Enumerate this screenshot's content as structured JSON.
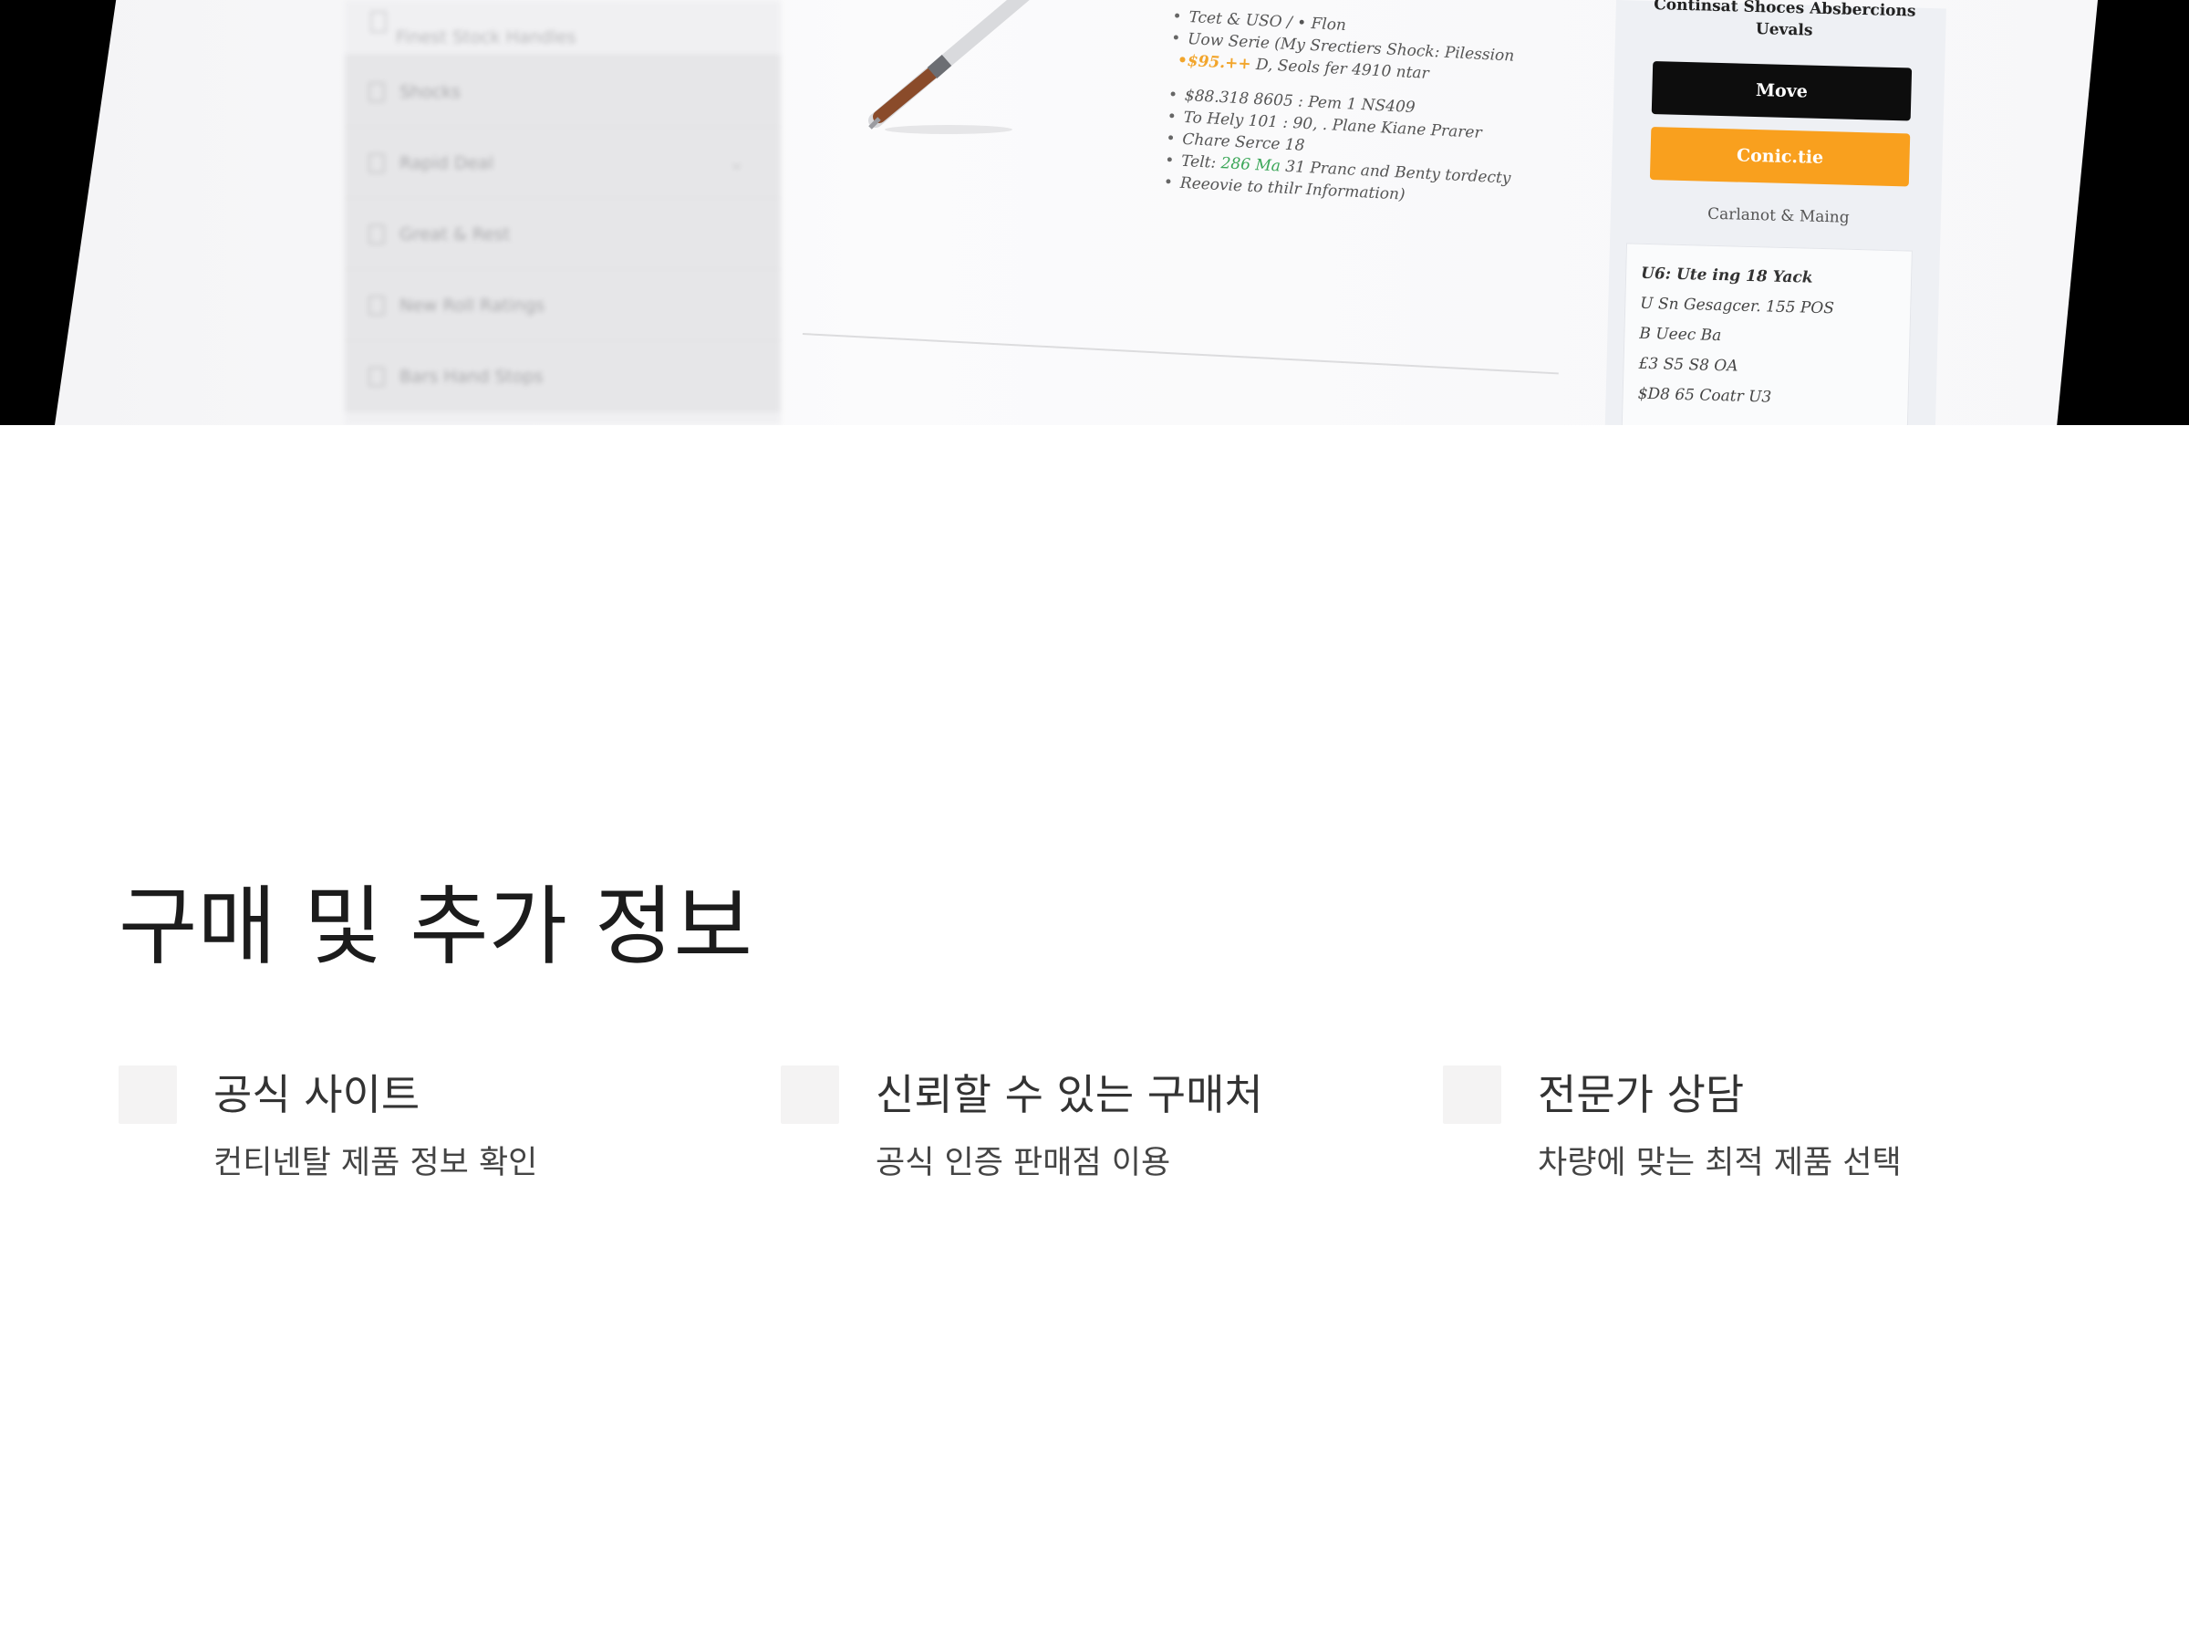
{
  "hero": {
    "sidebar": {
      "top_item": "Finest Stock Handles",
      "items": [
        "Shocks",
        "Rapid Deal",
        "Great & Rest",
        "New Roll Ratings",
        "Bars Hand Stops"
      ]
    },
    "specs": [
      {
        "text": "Tcet & USO / • Flon"
      },
      {
        "text": "Uow Serie (My Srectiers Shock: Pilession"
      },
      {
        "prefix": "•$95.++",
        "text": " D, Seols fer 4910 ntar"
      },
      {
        "text": "$88.318 8605 : Pem 1 NS409"
      },
      {
        "text": "To Hely 101 : 90, . Plane Kiane Prarer"
      },
      {
        "text": "Chare Serce 18"
      },
      {
        "prefix_plain": "Telt: ",
        "green": "286 Ma",
        "text": " 31 Pranc and Benty tordecty"
      },
      {
        "text": "Reeovie to thilr Information)"
      }
    ],
    "buybox": {
      "title_1": "Continsat Shoces Absbercions",
      "title_2": "Uevals",
      "btn_primary": "Move",
      "btn_secondary": "Conic.tie",
      "link": "Carlanot & Maing",
      "shipping": [
        "U6: Ute ing 18 Yack",
        "U Sn Gesagcer. 155 POS",
        "B Ueec Ba",
        "£3 S5 S8 OA",
        "$D8 65 Coatr U3"
      ]
    }
  },
  "section": {
    "title": "구매 및 추가 정보",
    "cards": [
      {
        "title": "공식 사이트",
        "desc": "컨티넨탈 제품 정보 확인"
      },
      {
        "title": "신뢰할 수 있는 구매처",
        "desc": "공식 인증 판매점 이용"
      },
      {
        "title": "전문가 상담",
        "desc": "차량에 맞는 최적 제품 선택"
      }
    ]
  }
}
